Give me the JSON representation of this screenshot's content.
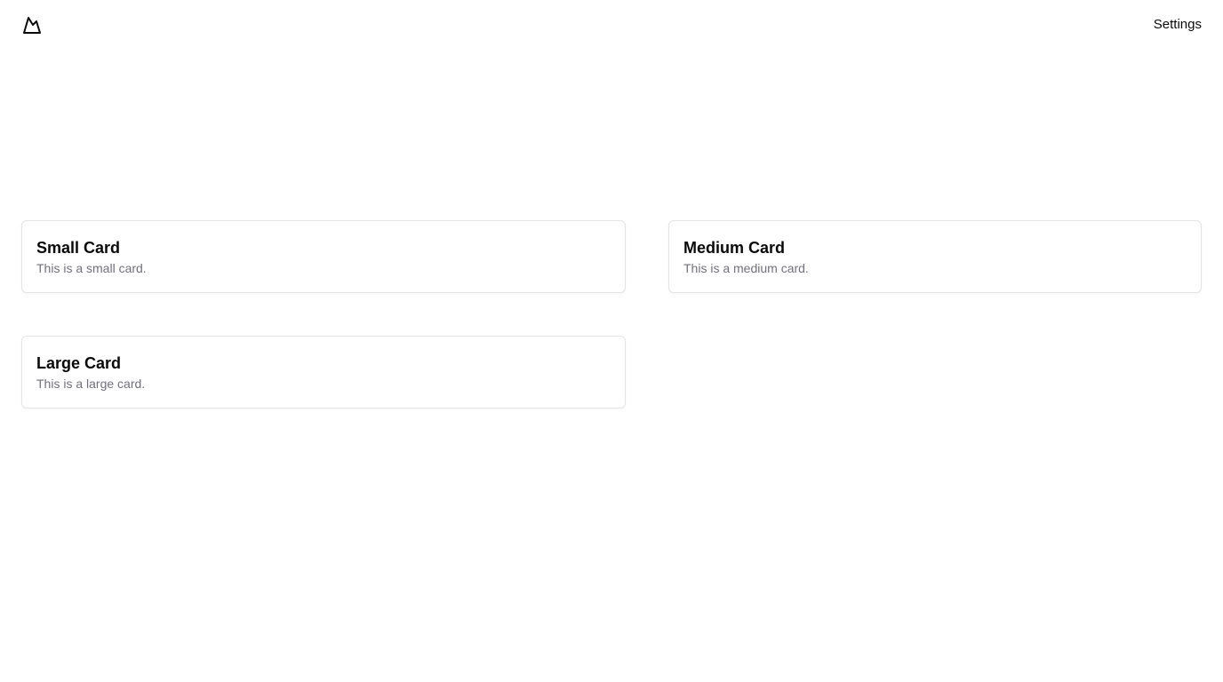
{
  "header": {
    "logo_icon": "mountain-logo-icon",
    "settings_label": "Settings"
  },
  "cards": [
    {
      "title": "Small Card",
      "description": "This is a small card."
    },
    {
      "title": "Medium Card",
      "description": "This is a medium card."
    },
    {
      "title": "Large Card",
      "description": "This is a large card."
    }
  ],
  "colors": {
    "text": "#0a0a0a",
    "muted_text": "#71717a",
    "border": "#e4e4e7",
    "background": "#ffffff"
  }
}
